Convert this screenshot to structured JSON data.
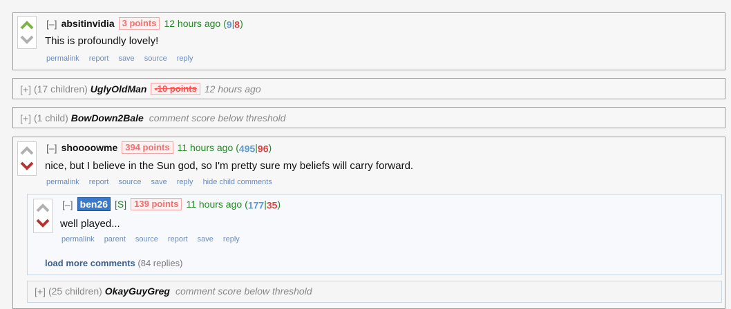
{
  "comments": {
    "c1": {
      "toggle": "[–]",
      "user": "absitinvidia",
      "points": "3 points",
      "time": "12 hours ago",
      "up": "9",
      "down": "8",
      "body": "This is profoundly lovely!",
      "links": [
        "permalink",
        "report",
        "save",
        "source",
        "reply"
      ]
    },
    "c2": {
      "toggle": "[+]",
      "children": "(17 children)",
      "user": "UglyOldMan",
      "points": "-10 points",
      "time": "12 hours ago"
    },
    "c3": {
      "toggle": "[+]",
      "children": "(1 child)",
      "user": "BowDown2Bale",
      "status": "comment score below threshold"
    },
    "c4": {
      "toggle": "[–]",
      "user": "shoooowme",
      "points": "394 points",
      "time": "11 hours ago",
      "up": "495",
      "down": "96",
      "body": "nice, but I believe in the Sun god, so I'm pretty sure my beliefs will carry forward.",
      "links": [
        "permalink",
        "report",
        "source",
        "save",
        "reply",
        "hide child comments"
      ]
    },
    "c5": {
      "toggle": "[–]",
      "user": "ben26",
      "submitter": "[S]",
      "points": "139 points",
      "time": "11 hours ago",
      "up": "177",
      "down": "35",
      "body": "well played...",
      "links": [
        "permalink",
        "parent",
        "source",
        "report",
        "save",
        "reply"
      ]
    },
    "more": {
      "label": "load more comments",
      "count": "(84 replies)"
    },
    "c6": {
      "toggle": "[+]",
      "children": "(25 children)",
      "user": "OkayGuyGreg",
      "status": "comment score below threshold"
    }
  },
  "colors": {
    "upvote": "#5b9bd5",
    "downvote": "#e04040",
    "time": "#228822",
    "link": "#6a8bbf"
  }
}
